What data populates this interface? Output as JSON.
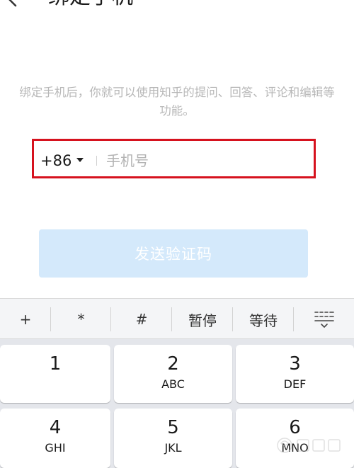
{
  "header": {
    "title": "绑定手机",
    "back_icon": "chevron-left-icon"
  },
  "main": {
    "description": "绑定手机后，你就可以使用知乎的提问、回答、评论和编辑等功能。",
    "phone": {
      "country_code": "+86",
      "placeholder": "手机号",
      "value": ""
    },
    "send_button_label": "发送验证码"
  },
  "keyboard": {
    "symbols": [
      "+",
      "*",
      "#",
      "暂停",
      "等待"
    ],
    "collapse_icon": "keyboard-collapse-icon",
    "keys": [
      {
        "digit": "1",
        "letters": ""
      },
      {
        "digit": "2",
        "letters": "ABC"
      },
      {
        "digit": "3",
        "letters": "DEF"
      },
      {
        "digit": "4",
        "letters": "GHI"
      },
      {
        "digit": "5",
        "letters": "JKL"
      },
      {
        "digit": "6",
        "letters": "MNO"
      }
    ]
  },
  "colors": {
    "highlight_border": "#d6121e",
    "button_disabled_bg": "#d4e9fb",
    "hint_text": "#b8b8b8",
    "keyboard_bg": "#e4e6eb"
  }
}
